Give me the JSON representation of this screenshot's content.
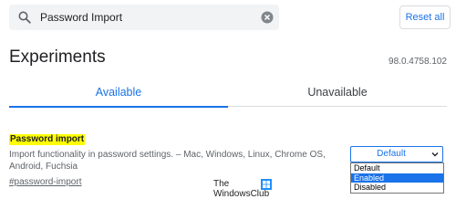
{
  "search": {
    "value": "Password Import",
    "placeholder": "Search flags",
    "reset_label": "Reset all"
  },
  "header": {
    "title": "Experiments",
    "version": "98.0.4758.102"
  },
  "tabs": [
    {
      "label": "Available",
      "active": true
    },
    {
      "label": "Unavailable",
      "active": false
    }
  ],
  "experiment": {
    "title": "Password import",
    "description": "Import functionality in password settings. – Mac, Windows, Linux, Chrome OS, Android, Fuchsia",
    "link": "#password-import"
  },
  "dropdown": {
    "selected_display": "Default",
    "options": [
      "Default",
      "Enabled",
      "Disabled"
    ],
    "highlighted": "Enabled"
  },
  "watermark": {
    "line1": "The",
    "line2": "WindowsClub"
  },
  "colors": {
    "accent": "#1a73e8",
    "highlight": "#ffff00",
    "search_bg": "#f1f3f4"
  }
}
